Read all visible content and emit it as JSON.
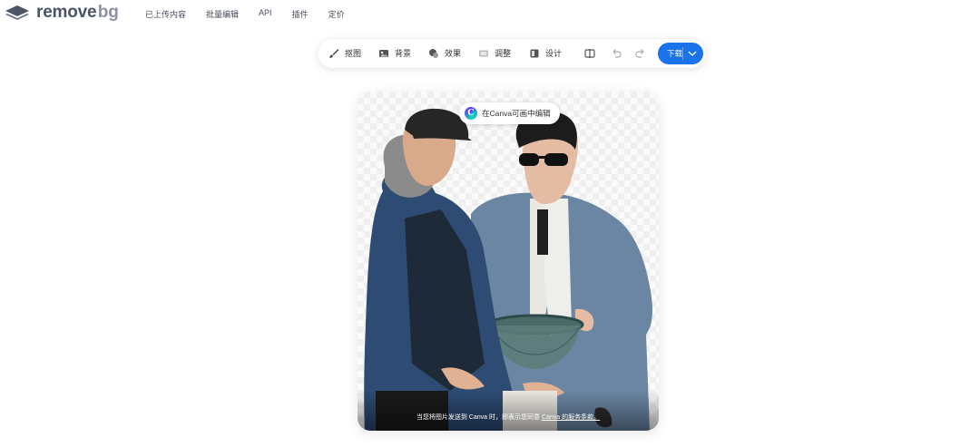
{
  "brand": {
    "name_main": "remove",
    "name_suffix": "bg",
    "color": "#4c5566"
  },
  "nav": {
    "items": [
      "已上传内容",
      "批量编辑",
      "API",
      "插件",
      "定价"
    ]
  },
  "toolbar": {
    "tools": [
      {
        "label": "抠图",
        "icon": "brush-icon"
      },
      {
        "label": "背景",
        "icon": "image-icon"
      },
      {
        "label": "效果",
        "icon": "effects-icon"
      },
      {
        "label": "调整",
        "icon": "adjust-icon"
      },
      {
        "label": "设计",
        "icon": "design-icon"
      }
    ],
    "compare_icon": "compare-icon",
    "undo_icon": "undo-icon",
    "redo_icon": "redo-icon",
    "download_label": "下载",
    "accent": "#1a73e8"
  },
  "canvas": {
    "canva_button": "在Canva可画中编辑",
    "notice_prefix": "当您将图片发送到 Canva 时，即表示您同意 ",
    "notice_link": "Canva 的服务条款。",
    "checker_color": "#efefef"
  }
}
